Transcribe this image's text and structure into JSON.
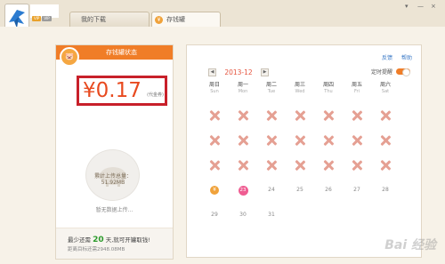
{
  "header": {
    "vip_badges": [
      "VIP",
      "VIP"
    ]
  },
  "tabs": [
    {
      "label": "我的下载"
    },
    {
      "label": "存钱罐",
      "icon": "piggy-bank-icon"
    }
  ],
  "window_controls": [
    "▾",
    "—",
    "×"
  ],
  "piggy_card": {
    "title": "存钱罐状态",
    "amount": "¥0.17",
    "amount_unit": "(代金券)",
    "bubble_line1": "累计上传总量：",
    "bubble_line2": "51.92MB",
    "no_upload_text": "暂无数据上传...",
    "footer_prefix": "最少还需",
    "footer_days": "20",
    "footer_suffix": "天,就可开罐取钱!",
    "footer_sub": "距离目标还需2948.08MB"
  },
  "calendar": {
    "links": [
      "反馈",
      "帮助"
    ],
    "month": "2013-12",
    "reminder_label": "定时提醒",
    "reminder_on": true,
    "weekdays": [
      {
        "cn": "周日",
        "en": "Sun"
      },
      {
        "cn": "周一",
        "en": "Mon"
      },
      {
        "cn": "周二",
        "en": "Tue"
      },
      {
        "cn": "周三",
        "en": "Wed"
      },
      {
        "cn": "周四",
        "en": "Thu"
      },
      {
        "cn": "周五",
        "en": "Fri"
      },
      {
        "cn": "周六",
        "en": "Sat"
      }
    ],
    "rows": [
      [
        "x",
        "x",
        "x",
        "x",
        "x",
        "x",
        "x"
      ],
      [
        "x",
        "x",
        "x",
        "x",
        "x",
        "x",
        "x"
      ],
      [
        "x",
        "x",
        "x",
        "x",
        "x",
        "x",
        "x"
      ],
      [
        "coin",
        "23",
        "24",
        "25",
        "26",
        "27",
        "28"
      ],
      [
        "29",
        "30",
        "31",
        "",
        "",
        "",
        ""
      ]
    ],
    "today": "23",
    "coin_symbol": "¥"
  },
  "watermark": "Bai 经验",
  "colors": {
    "accent": "#f07d27",
    "amount": "#e84a1f",
    "highlight_border": "#c8202a",
    "today": "#ef5d92",
    "days_green": "#2c9b2c"
  }
}
